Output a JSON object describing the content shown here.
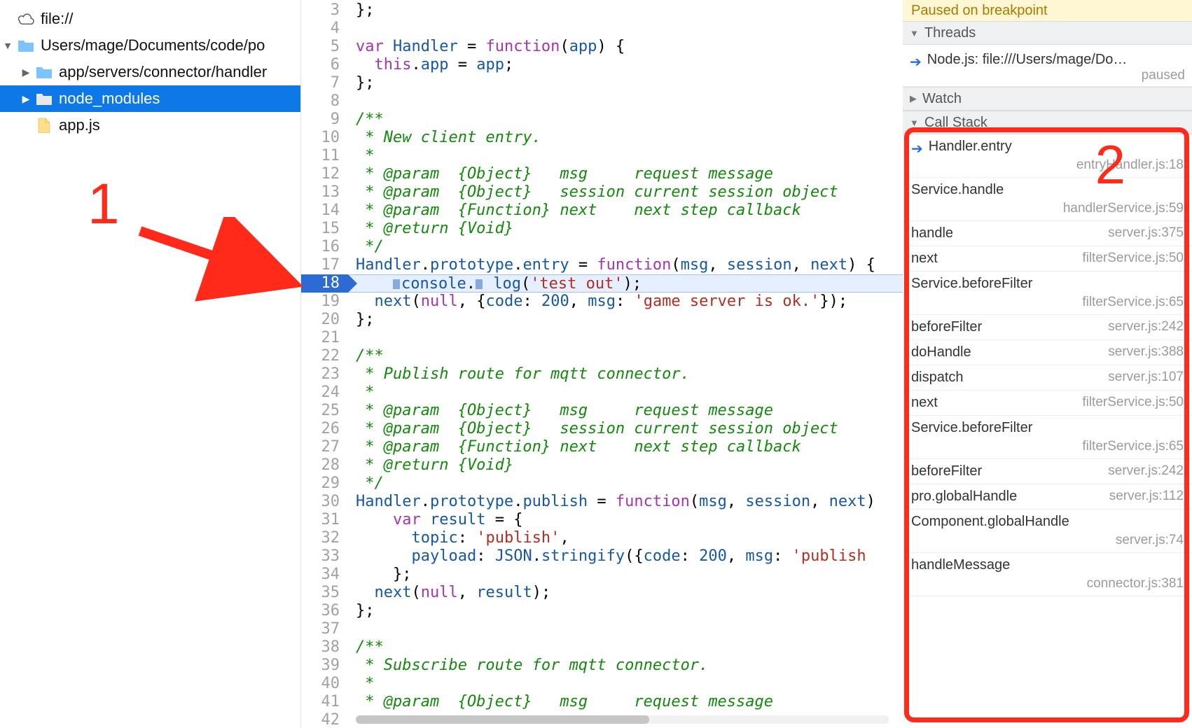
{
  "tree": {
    "root_label": "file://",
    "project_path": "Users/mage/Documents/code/po",
    "items": [
      {
        "label": "app/servers/connector/handler",
        "type": "folder",
        "expanded": false,
        "indent": 1,
        "selected": false,
        "pale": false
      },
      {
        "label": "node_modules",
        "type": "folder",
        "expanded": false,
        "indent": 1,
        "selected": true,
        "pale": true
      },
      {
        "label": "app.js",
        "type": "file",
        "expanded": false,
        "indent": 1,
        "selected": false,
        "pale": false
      }
    ]
  },
  "editor": {
    "first_line": 3,
    "breakpoint_line": 18,
    "lines": [
      {
        "n": 3,
        "tokens": [
          [
            "};",
            "pl"
          ]
        ]
      },
      {
        "n": 4,
        "tokens": [
          [
            "",
            "pl"
          ]
        ]
      },
      {
        "n": 5,
        "tokens": [
          [
            "var",
            "kw"
          ],
          [
            " Handler ",
            "prop"
          ],
          [
            "=",
            "pl"
          ],
          [
            " function",
            "kw"
          ],
          [
            "(",
            "pl"
          ],
          [
            "app",
            "prop"
          ],
          [
            ") {",
            "pl"
          ]
        ]
      },
      {
        "n": 6,
        "tokens": [
          [
            "  ",
            "pl"
          ],
          [
            "this",
            "kw"
          ],
          [
            ".",
            "pl"
          ],
          [
            "app",
            "prop"
          ],
          [
            " = ",
            "pl"
          ],
          [
            "app",
            "prop"
          ],
          [
            ";",
            "pl"
          ]
        ]
      },
      {
        "n": 7,
        "tokens": [
          [
            "};",
            "pl"
          ]
        ]
      },
      {
        "n": 8,
        "tokens": [
          [
            "",
            "pl"
          ]
        ]
      },
      {
        "n": 9,
        "tokens": [
          [
            "/**",
            "com"
          ]
        ]
      },
      {
        "n": 10,
        "tokens": [
          [
            " * New client entry.",
            "com"
          ]
        ]
      },
      {
        "n": 11,
        "tokens": [
          [
            " *",
            "com"
          ]
        ]
      },
      {
        "n": 12,
        "tokens": [
          [
            " * @param  {Object}   msg     request message",
            "com"
          ]
        ]
      },
      {
        "n": 13,
        "tokens": [
          [
            " * @param  {Object}   session current session object",
            "com"
          ]
        ]
      },
      {
        "n": 14,
        "tokens": [
          [
            " * @param  {Function} next    next step callback",
            "com"
          ]
        ]
      },
      {
        "n": 15,
        "tokens": [
          [
            " * @return {Void}",
            "com"
          ]
        ]
      },
      {
        "n": 16,
        "tokens": [
          [
            " */",
            "com"
          ]
        ]
      },
      {
        "n": 17,
        "tokens": [
          [
            "Handler",
            "prop"
          ],
          [
            ".",
            "pl"
          ],
          [
            "prototype",
            "prop"
          ],
          [
            ".",
            "pl"
          ],
          [
            "entry",
            "prop"
          ],
          [
            " = ",
            "pl"
          ],
          [
            "function",
            "kw"
          ],
          [
            "(",
            "pl"
          ],
          [
            "msg",
            "prop"
          ],
          [
            ", ",
            "pl"
          ],
          [
            "session",
            "prop"
          ],
          [
            ", ",
            "pl"
          ],
          [
            "next",
            "prop"
          ],
          [
            ") {",
            "pl"
          ]
        ]
      },
      {
        "n": 18,
        "bp": true,
        "tokens": [
          [
            "    ",
            "pl"
          ],
          [
            "console",
            "prop"
          ],
          [
            ".",
            "pl"
          ],
          [
            " log",
            "prop"
          ],
          [
            "(",
            "pl"
          ],
          [
            "'test out'",
            "str"
          ],
          [
            ");",
            "pl"
          ]
        ]
      },
      {
        "n": 19,
        "tokens": [
          [
            "  ",
            "pl"
          ],
          [
            "next",
            "prop"
          ],
          [
            "(",
            "pl"
          ],
          [
            "null",
            "kw"
          ],
          [
            ", {",
            "pl"
          ],
          [
            "code",
            "prop"
          ],
          [
            ": ",
            "pl"
          ],
          [
            "200",
            "num"
          ],
          [
            ", ",
            "pl"
          ],
          [
            "msg",
            "prop"
          ],
          [
            ": ",
            "pl"
          ],
          [
            "'game server is ok.'",
            "str"
          ],
          [
            "});",
            "pl"
          ]
        ]
      },
      {
        "n": 20,
        "tokens": [
          [
            "};",
            "pl"
          ]
        ]
      },
      {
        "n": 21,
        "tokens": [
          [
            "",
            "pl"
          ]
        ]
      },
      {
        "n": 22,
        "tokens": [
          [
            "/**",
            "com"
          ]
        ]
      },
      {
        "n": 23,
        "tokens": [
          [
            " * Publish route for mqtt connector.",
            "com"
          ]
        ]
      },
      {
        "n": 24,
        "tokens": [
          [
            " *",
            "com"
          ]
        ]
      },
      {
        "n": 25,
        "tokens": [
          [
            " * @param  {Object}   msg     request message",
            "com"
          ]
        ]
      },
      {
        "n": 26,
        "tokens": [
          [
            " * @param  {Object}   session current session object",
            "com"
          ]
        ]
      },
      {
        "n": 27,
        "tokens": [
          [
            " * @param  {Function} next    next step callback",
            "com"
          ]
        ]
      },
      {
        "n": 28,
        "tokens": [
          [
            " * @return {Void}",
            "com"
          ]
        ]
      },
      {
        "n": 29,
        "tokens": [
          [
            " */",
            "com"
          ]
        ]
      },
      {
        "n": 30,
        "tokens": [
          [
            "Handler",
            "prop"
          ],
          [
            ".",
            "pl"
          ],
          [
            "prototype",
            "prop"
          ],
          [
            ".",
            "pl"
          ],
          [
            "publish",
            "prop"
          ],
          [
            " = ",
            "pl"
          ],
          [
            "function",
            "kw"
          ],
          [
            "(",
            "pl"
          ],
          [
            "msg",
            "prop"
          ],
          [
            ", ",
            "pl"
          ],
          [
            "session",
            "prop"
          ],
          [
            ", ",
            "pl"
          ],
          [
            "next",
            "prop"
          ],
          [
            ") ",
            "pl"
          ]
        ]
      },
      {
        "n": 31,
        "tokens": [
          [
            "    ",
            "pl"
          ],
          [
            "var",
            "kw"
          ],
          [
            " result ",
            "prop"
          ],
          [
            "= {",
            "pl"
          ]
        ]
      },
      {
        "n": 32,
        "tokens": [
          [
            "      ",
            "pl"
          ],
          [
            "topic",
            "prop"
          ],
          [
            ": ",
            "pl"
          ],
          [
            "'publish'",
            "str"
          ],
          [
            ",",
            "pl"
          ]
        ]
      },
      {
        "n": 33,
        "tokens": [
          [
            "      ",
            "pl"
          ],
          [
            "payload",
            "prop"
          ],
          [
            ": ",
            "pl"
          ],
          [
            "JSON",
            "prop"
          ],
          [
            ".",
            "pl"
          ],
          [
            "stringify",
            "prop"
          ],
          [
            "({",
            "pl"
          ],
          [
            "code",
            "prop"
          ],
          [
            ": ",
            "pl"
          ],
          [
            "200",
            "num"
          ],
          [
            ", ",
            "pl"
          ],
          [
            "msg",
            "prop"
          ],
          [
            ": ",
            "pl"
          ],
          [
            "'publish",
            "str"
          ]
        ]
      },
      {
        "n": 34,
        "tokens": [
          [
            "    };",
            "pl"
          ]
        ]
      },
      {
        "n": 35,
        "tokens": [
          [
            "  ",
            "pl"
          ],
          [
            "next",
            "prop"
          ],
          [
            "(",
            "pl"
          ],
          [
            "null",
            "kw"
          ],
          [
            ", ",
            "pl"
          ],
          [
            "result",
            "prop"
          ],
          [
            ");",
            "pl"
          ]
        ]
      },
      {
        "n": 36,
        "tokens": [
          [
            "};",
            "pl"
          ]
        ]
      },
      {
        "n": 37,
        "tokens": [
          [
            "",
            "pl"
          ]
        ]
      },
      {
        "n": 38,
        "tokens": [
          [
            "/**",
            "com"
          ]
        ]
      },
      {
        "n": 39,
        "tokens": [
          [
            " * Subscribe route for mqtt connector.",
            "com"
          ]
        ]
      },
      {
        "n": 40,
        "tokens": [
          [
            " *",
            "com"
          ]
        ]
      },
      {
        "n": 41,
        "tokens": [
          [
            " * @param  {Object}   msg     request message",
            "com"
          ]
        ]
      },
      {
        "n": 42,
        "tokens": [
          [
            "",
            "pl"
          ]
        ]
      }
    ]
  },
  "debugger": {
    "paused_banner": "Paused on breakpoint",
    "sections": {
      "threads": "Threads",
      "watch": "Watch",
      "callstack": "Call Stack"
    },
    "thread": {
      "title": "Node.js: file:///Users/mage/Do…",
      "status": "paused"
    },
    "stack": [
      {
        "name": "Handler.entry",
        "loc": "entryHandler.js:18",
        "top": true,
        "twoline": true
      },
      {
        "name": "Service.handle",
        "loc": "handlerService.js:59",
        "top": false,
        "twoline": true
      },
      {
        "name": "handle",
        "loc": "server.js:375",
        "top": false,
        "twoline": false
      },
      {
        "name": "next",
        "loc": "filterService.js:50",
        "top": false,
        "twoline": false
      },
      {
        "name": "Service.beforeFilter",
        "loc": "filterService.js:65",
        "top": false,
        "twoline": true
      },
      {
        "name": "beforeFilter",
        "loc": "server.js:242",
        "top": false,
        "twoline": false
      },
      {
        "name": "doHandle",
        "loc": "server.js:388",
        "top": false,
        "twoline": false
      },
      {
        "name": "dispatch",
        "loc": "server.js:107",
        "top": false,
        "twoline": false
      },
      {
        "name": "next",
        "loc": "filterService.js:50",
        "top": false,
        "twoline": false
      },
      {
        "name": "Service.beforeFilter",
        "loc": "filterService.js:65",
        "top": false,
        "twoline": true
      },
      {
        "name": "beforeFilter",
        "loc": "server.js:242",
        "top": false,
        "twoline": false
      },
      {
        "name": "pro.globalHandle",
        "loc": "server.js:112",
        "top": false,
        "twoline": false
      },
      {
        "name": "Component.globalHandle",
        "loc": "server.js:74",
        "top": false,
        "twoline": true
      },
      {
        "name": "handleMessage",
        "loc": "connector.js:381",
        "top": false,
        "twoline": true
      }
    ]
  },
  "annotations": {
    "one": "1",
    "two": "2"
  }
}
